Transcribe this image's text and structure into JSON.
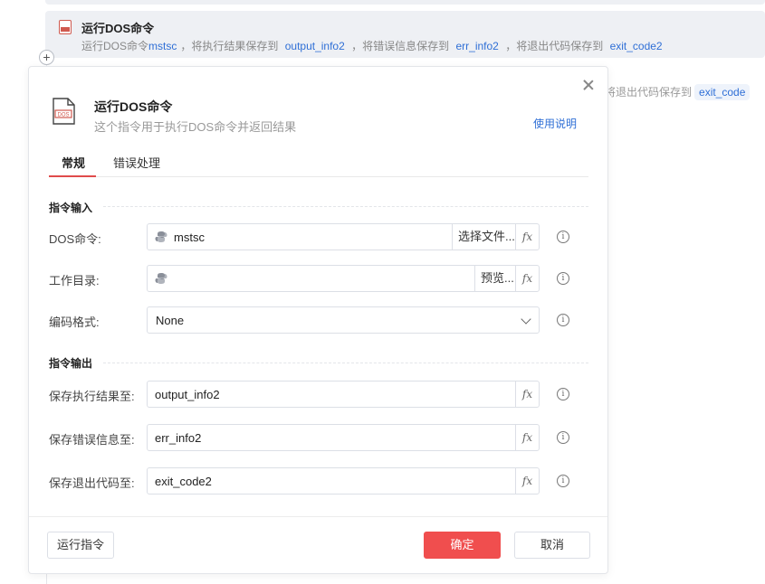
{
  "workflow": {
    "step": {
      "title": "运行DOS命令",
      "desc_prefix": "运行DOS命令",
      "command": "mstsc",
      "desc_mid1": "，将执行结果保存到",
      "output_var": "output_info2",
      "desc_mid2": "，将错误信息保存到",
      "error_var": "err_info2",
      "desc_mid3": "，将退出代码保存到",
      "exit_var": "exit_code2"
    },
    "add_label": "+",
    "behind_text": "将退出代码保存到",
    "behind_chip": "exit_code"
  },
  "dialog": {
    "title": "运行DOS命令",
    "subtitle": "这个指令用于执行DOS命令并返回结果",
    "help_link": "使用说明",
    "tabs": [
      "常规",
      "错误处理"
    ],
    "active_tab": 0,
    "input_section": "指令输入",
    "output_section": "指令输出",
    "fields": {
      "dos_command": {
        "label": "DOS命令:",
        "value": "mstsc",
        "button": "选择文件..."
      },
      "work_dir": {
        "label": "工作目录:",
        "value": "",
        "button": "预览..."
      },
      "encoding": {
        "label": "编码格式:",
        "value": "None"
      },
      "save_output": {
        "label": "保存执行结果至:",
        "value": "output_info2"
      },
      "save_error": {
        "label": "保存错误信息至:",
        "value": "err_info2"
      },
      "save_exit": {
        "label": "保存退出代码至:",
        "value": "exit_code2"
      }
    },
    "fx_label": "fx",
    "info_label": "i",
    "icon_text": "DOS",
    "buttons": {
      "run": "运行指令",
      "ok": "确定",
      "cancel": "取消"
    }
  },
  "colors": {
    "accent": "#f04e4e",
    "link": "#2f6fd6",
    "tab_underline": "#e04b4b"
  },
  "icons": [
    "close-icon",
    "python-icon",
    "fx-icon",
    "info-icon",
    "chevron-down-icon",
    "doc-file-icon"
  ]
}
